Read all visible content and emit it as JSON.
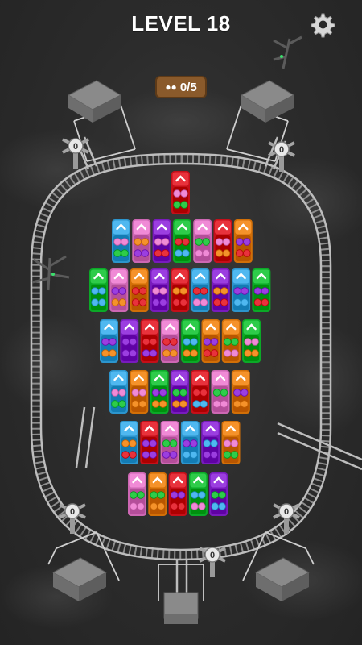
{
  "header": {
    "level_label": "LEVEL 18",
    "settings_icon": "gear-icon"
  },
  "counter": {
    "icon": "train-icon",
    "text": "0/5"
  },
  "stations": [
    {
      "name": "station-top-left",
      "count": "0"
    },
    {
      "name": "station-top-right",
      "count": "0"
    },
    {
      "name": "station-bottom-left",
      "count": "0"
    },
    {
      "name": "station-bottom-center",
      "count": "0"
    },
    {
      "name": "station-bottom-right",
      "count": "0"
    }
  ],
  "palette": {
    "red": "#e8323c",
    "green": "#2ecc4a",
    "blue": "#4fb8f0",
    "purple": "#9b3ee0",
    "pink": "#f08ad6",
    "orange": "#f5922a"
  },
  "grid": {
    "rows": [
      {
        "cars": [
          {
            "c": "red",
            "p": [
              "pink",
              "green"
            ]
          }
        ]
      },
      {
        "cars": [
          {
            "c": "blue",
            "p": [
              "pink",
              "green"
            ]
          },
          {
            "c": "pink",
            "p": [
              "orange",
              "purple"
            ]
          },
          {
            "c": "purple",
            "p": [
              "pink",
              "red"
            ]
          },
          {
            "c": "green",
            "p": [
              "red",
              "blue"
            ]
          },
          {
            "c": "pink",
            "p": [
              "green",
              "pink"
            ]
          },
          {
            "c": "red",
            "p": [
              "pink",
              "orange"
            ]
          },
          {
            "c": "orange",
            "p": [
              "purple",
              "red"
            ]
          }
        ]
      },
      {
        "cars": [
          {
            "c": "green",
            "p": [
              "blue",
              "blue"
            ]
          },
          {
            "c": "pink",
            "p": [
              "purple",
              "orange"
            ]
          },
          {
            "c": "orange",
            "p": [
              "red",
              "red"
            ]
          },
          {
            "c": "purple",
            "p": [
              "pink",
              "purple"
            ]
          },
          {
            "c": "red",
            "p": [
              "orange",
              "red"
            ]
          },
          {
            "c": "blue",
            "p": [
              "red",
              "pink"
            ]
          },
          {
            "c": "purple",
            "p": [
              "orange",
              "red"
            ]
          },
          {
            "c": "blue",
            "p": [
              "purple",
              "blue"
            ]
          },
          {
            "c": "green",
            "p": [
              "purple",
              "red"
            ]
          }
        ]
      },
      {
        "cars": [
          {
            "c": "blue",
            "p": [
              "purple",
              "orange"
            ]
          },
          {
            "c": "purple",
            "p": [
              "purple",
              "purple"
            ]
          },
          {
            "c": "red",
            "p": [
              "red",
              "purple"
            ]
          },
          {
            "c": "pink",
            "p": [
              "red",
              "orange"
            ]
          },
          {
            "c": "green",
            "p": [
              "blue",
              "orange"
            ]
          },
          {
            "c": "orange",
            "p": [
              "purple",
              "red"
            ]
          },
          {
            "c": "orange",
            "p": [
              "green",
              "pink"
            ]
          },
          {
            "c": "green",
            "p": [
              "pink",
              "orange"
            ]
          }
        ]
      },
      {
        "cars": [
          {
            "c": "blue",
            "p": [
              "pink",
              "green"
            ]
          },
          {
            "c": "orange",
            "p": [
              "pink",
              "orange"
            ]
          },
          {
            "c": "green",
            "p": [
              "purple",
              "orange"
            ]
          },
          {
            "c": "purple",
            "p": [
              "green",
              "orange"
            ]
          },
          {
            "c": "red",
            "p": [
              "red",
              "blue"
            ]
          },
          {
            "c": "pink",
            "p": [
              "green",
              "pink"
            ]
          },
          {
            "c": "orange",
            "p": [
              "purple",
              "orange"
            ]
          }
        ]
      },
      {
        "cars": [
          {
            "c": "blue",
            "p": [
              "orange",
              "red"
            ]
          },
          {
            "c": "red",
            "p": [
              "purple",
              "purple"
            ]
          },
          {
            "c": "pink",
            "p": [
              "green",
              "purple"
            ]
          },
          {
            "c": "blue",
            "p": [
              "purple",
              "blue"
            ]
          },
          {
            "c": "purple",
            "p": [
              "blue",
              "purple"
            ]
          },
          {
            "c": "orange",
            "p": [
              "pink",
              "green"
            ]
          }
        ]
      },
      {
        "cars": [
          {
            "c": "pink",
            "p": [
              "green",
              "pink"
            ]
          },
          {
            "c": "orange",
            "p": [
              "green",
              "orange"
            ]
          },
          {
            "c": "red",
            "p": [
              "purple",
              "red"
            ]
          },
          {
            "c": "green",
            "p": [
              "blue",
              "pink"
            ]
          },
          {
            "c": "purple",
            "p": [
              "green",
              "blue"
            ]
          }
        ]
      }
    ]
  }
}
